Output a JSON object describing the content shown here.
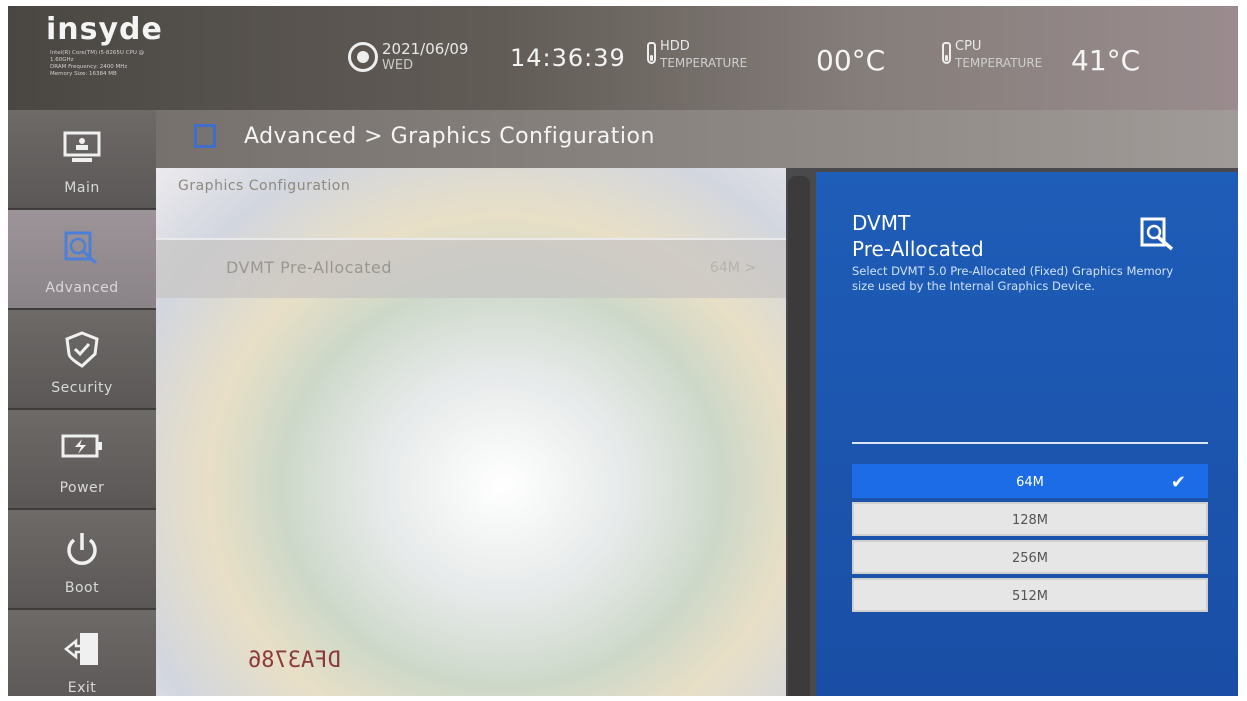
{
  "header": {
    "brand": "insyde",
    "system_info": [
      "Intel(R) Core(TM) i5-8265U CPU @",
      "1.60GHz",
      "DRAM Frequency: 2400 MHz",
      "Memory Size: 16384 MB"
    ],
    "date": "2021/06/09",
    "weekday": "WED",
    "time": "14:36:39",
    "hdd_label_1": "HDD",
    "hdd_label_2": "TEMPERATURE",
    "hdd_temperature": "00°C",
    "cpu_label_1": "CPU",
    "cpu_label_2": "TEMPERATURE",
    "cpu_temperature": "41°C"
  },
  "sidebar": {
    "items": [
      {
        "label": "Main",
        "icon": "monitor-icon"
      },
      {
        "label": "Advanced",
        "icon": "advanced-icon",
        "active": true
      },
      {
        "label": "Security",
        "icon": "shield-icon"
      },
      {
        "label": "Power",
        "icon": "battery-icon"
      },
      {
        "label": "Boot",
        "icon": "power-icon"
      },
      {
        "label": "Exit",
        "icon": "exit-icon"
      }
    ]
  },
  "breadcrumb": "Advanced > Graphics Configuration",
  "main": {
    "section_title": "Graphics Configuration",
    "setting": {
      "label": "DVMT Pre-Allocated",
      "value": "64M >"
    }
  },
  "overlay_watermark": "DFA3786",
  "info_panel": {
    "title": "DVMT\nPre-Allocated",
    "description": "Select DVMT 5.0 Pre-Allocated (Fixed) Graphics Memory size used by the Internal Graphics Device.",
    "options": [
      "64M",
      "128M",
      "256M",
      "512M"
    ],
    "selected": "64M",
    "check_mark": "✔"
  },
  "colors": {
    "accent_blue": "#1a4ea5",
    "selected_option": "#1c6ce8"
  }
}
